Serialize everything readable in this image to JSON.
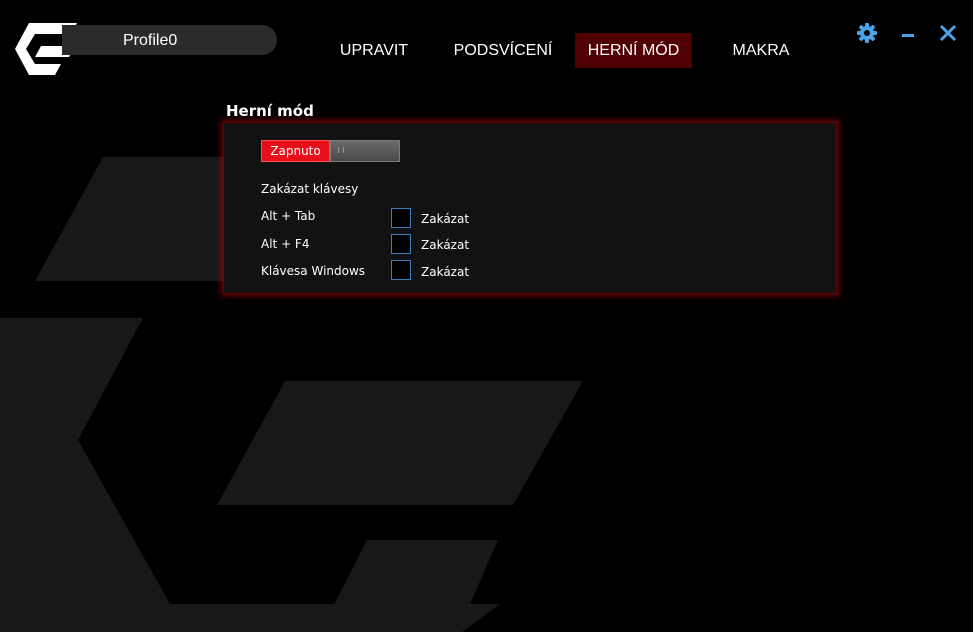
{
  "header": {
    "profile_name": "Profile0"
  },
  "nav": {
    "tabs": [
      {
        "label": "UPRAVIT",
        "active": false
      },
      {
        "label": "PODSVÍCENÍ",
        "active": false
      },
      {
        "label": "HERNÍ MÓD",
        "active": true
      },
      {
        "label": "MAKRA",
        "active": false
      }
    ]
  },
  "window_controls": {
    "icons": [
      "gear-icon",
      "minimize-icon",
      "close-icon"
    ],
    "color": "#4aa3e6"
  },
  "game_mode": {
    "title": "Herní mód",
    "toggle_label": "Zapnuto",
    "toggle_on": true,
    "disable_keys_heading": "Zakázat klávesy",
    "keys": [
      {
        "label": "Alt + Tab",
        "checkbox_label": "Zakázat",
        "checked": false
      },
      {
        "label": "Alt + F4",
        "checkbox_label": "Zakázat",
        "checked": false
      },
      {
        "label": "Klávesa Windows",
        "checkbox_label": "Zakázat",
        "checked": false
      }
    ]
  },
  "colors": {
    "accent_red": "#e60f1a",
    "active_tab_bg": "#500000",
    "panel_glow": "#c80000",
    "checkbox_border": "#3c7ec0"
  }
}
